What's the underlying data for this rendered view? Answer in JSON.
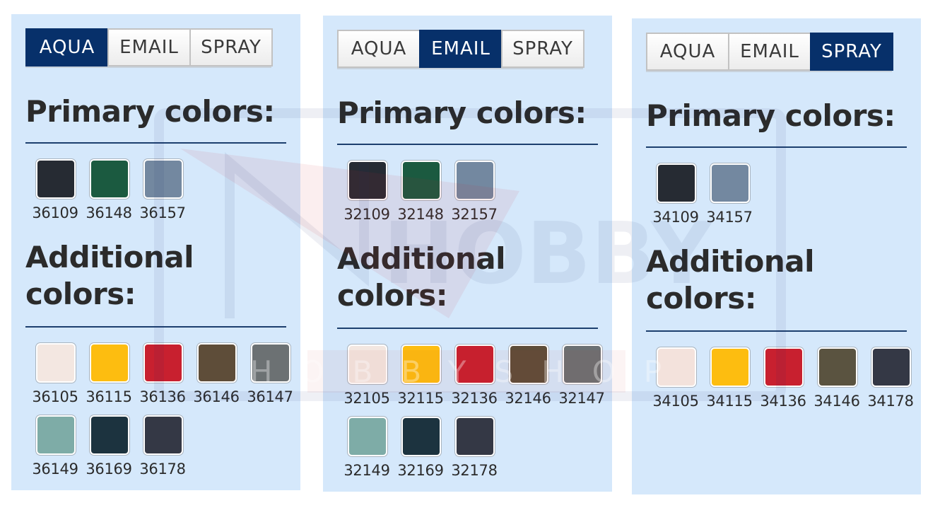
{
  "panels": [
    {
      "tabs": [
        "AQUA",
        "EMAIL",
        "SPRAY"
      ],
      "active_tab": 0,
      "primary_heading": "Primary colors:",
      "additional_heading": "Additional colors:",
      "primary": [
        {
          "code": "36109",
          "color": "#262b33"
        },
        {
          "code": "36148",
          "color": "#1b5a40"
        },
        {
          "code": "36157",
          "color": "#7388a0"
        }
      ],
      "additional": [
        {
          "code": "36105",
          "color": "#f3e7e1"
        },
        {
          "code": "36115",
          "color": "#fdbd10"
        },
        {
          "code": "36136",
          "color": "#c8202f"
        },
        {
          "code": "36146",
          "color": "#5e4d39"
        },
        {
          "code": "36147",
          "color": "#6c7173"
        },
        {
          "code": "36149",
          "color": "#7eaca7"
        },
        {
          "code": "36169",
          "color": "#1c333f"
        },
        {
          "code": "36178",
          "color": "#343845"
        }
      ]
    },
    {
      "tabs": [
        "AQUA",
        "EMAIL",
        "SPRAY"
      ],
      "active_tab": 1,
      "primary_heading": "Primary colors:",
      "additional_heading": "Additional colors:",
      "primary": [
        {
          "code": "32109",
          "color": "#262b33"
        },
        {
          "code": "32148",
          "color": "#1b5a40"
        },
        {
          "code": "32157",
          "color": "#7388a0"
        }
      ],
      "additional": [
        {
          "code": "32105",
          "color": "#f3e7e1"
        },
        {
          "code": "32115",
          "color": "#fdbd10"
        },
        {
          "code": "32136",
          "color": "#c8202f"
        },
        {
          "code": "32146",
          "color": "#5e4d39"
        },
        {
          "code": "32147",
          "color": "#6c7173"
        },
        {
          "code": "32149",
          "color": "#7eaca7"
        },
        {
          "code": "32169",
          "color": "#1c333f"
        },
        {
          "code": "32178",
          "color": "#343845"
        }
      ]
    },
    {
      "tabs": [
        "AQUA",
        "EMAIL",
        "SPRAY"
      ],
      "active_tab": 2,
      "primary_heading": "Primary colors:",
      "additional_heading": "Additional colors:",
      "primary": [
        {
          "code": "34109",
          "color": "#262b33"
        },
        {
          "code": "34157",
          "color": "#7388a0"
        }
      ],
      "additional": [
        {
          "code": "34105",
          "color": "#f3e2dc"
        },
        {
          "code": "34115",
          "color": "#fdbd10"
        },
        {
          "code": "34136",
          "color": "#c8202f"
        },
        {
          "code": "34146",
          "color": "#5a5340"
        },
        {
          "code": "34178",
          "color": "#343845"
        }
      ]
    }
  ],
  "colors": {
    "panel_bg": "#d5e8fb",
    "active_tab": "#07306a",
    "rule": "#1c3f6e",
    "text": "#2b2b2b"
  },
  "watermark": {
    "title": "HOBBY",
    "subtitle": "HOBBYSHOP"
  }
}
